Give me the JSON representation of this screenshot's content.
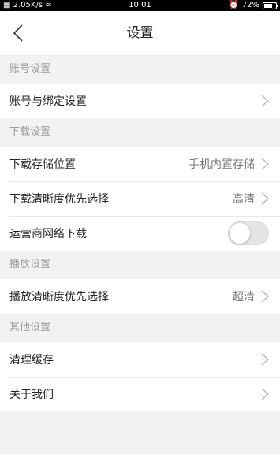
{
  "status_bar": {
    "network": "2.05K/s",
    "time": "10:01",
    "battery": "72%",
    "battery_level": 0.72
  },
  "navbar": {
    "title": "设置",
    "back_icon": "chevron-left-icon"
  },
  "sections": {
    "account": {
      "header": "账号设置",
      "binding_label": "账号与绑定设置"
    },
    "download": {
      "header": "下载设置",
      "storage_label": "下载存储位置",
      "storage_value": "手机内置存储",
      "quality_label": "下载清晰度优先选择",
      "quality_value": "高清",
      "carrier_label": "运营商网络下载",
      "carrier_enabled": false
    },
    "playback": {
      "header": "播放设置",
      "quality_label": "播放清晰度优先选择",
      "quality_value": "超清"
    },
    "other": {
      "header": "其他设置",
      "cache_label": "清理缓存",
      "about_label": "关于我们"
    }
  },
  "colors": {
    "background": "#f2f2f2",
    "section_text": "#9a9a9a",
    "row_bg": "#ffffff",
    "chevron": "#b5b5b5"
  }
}
